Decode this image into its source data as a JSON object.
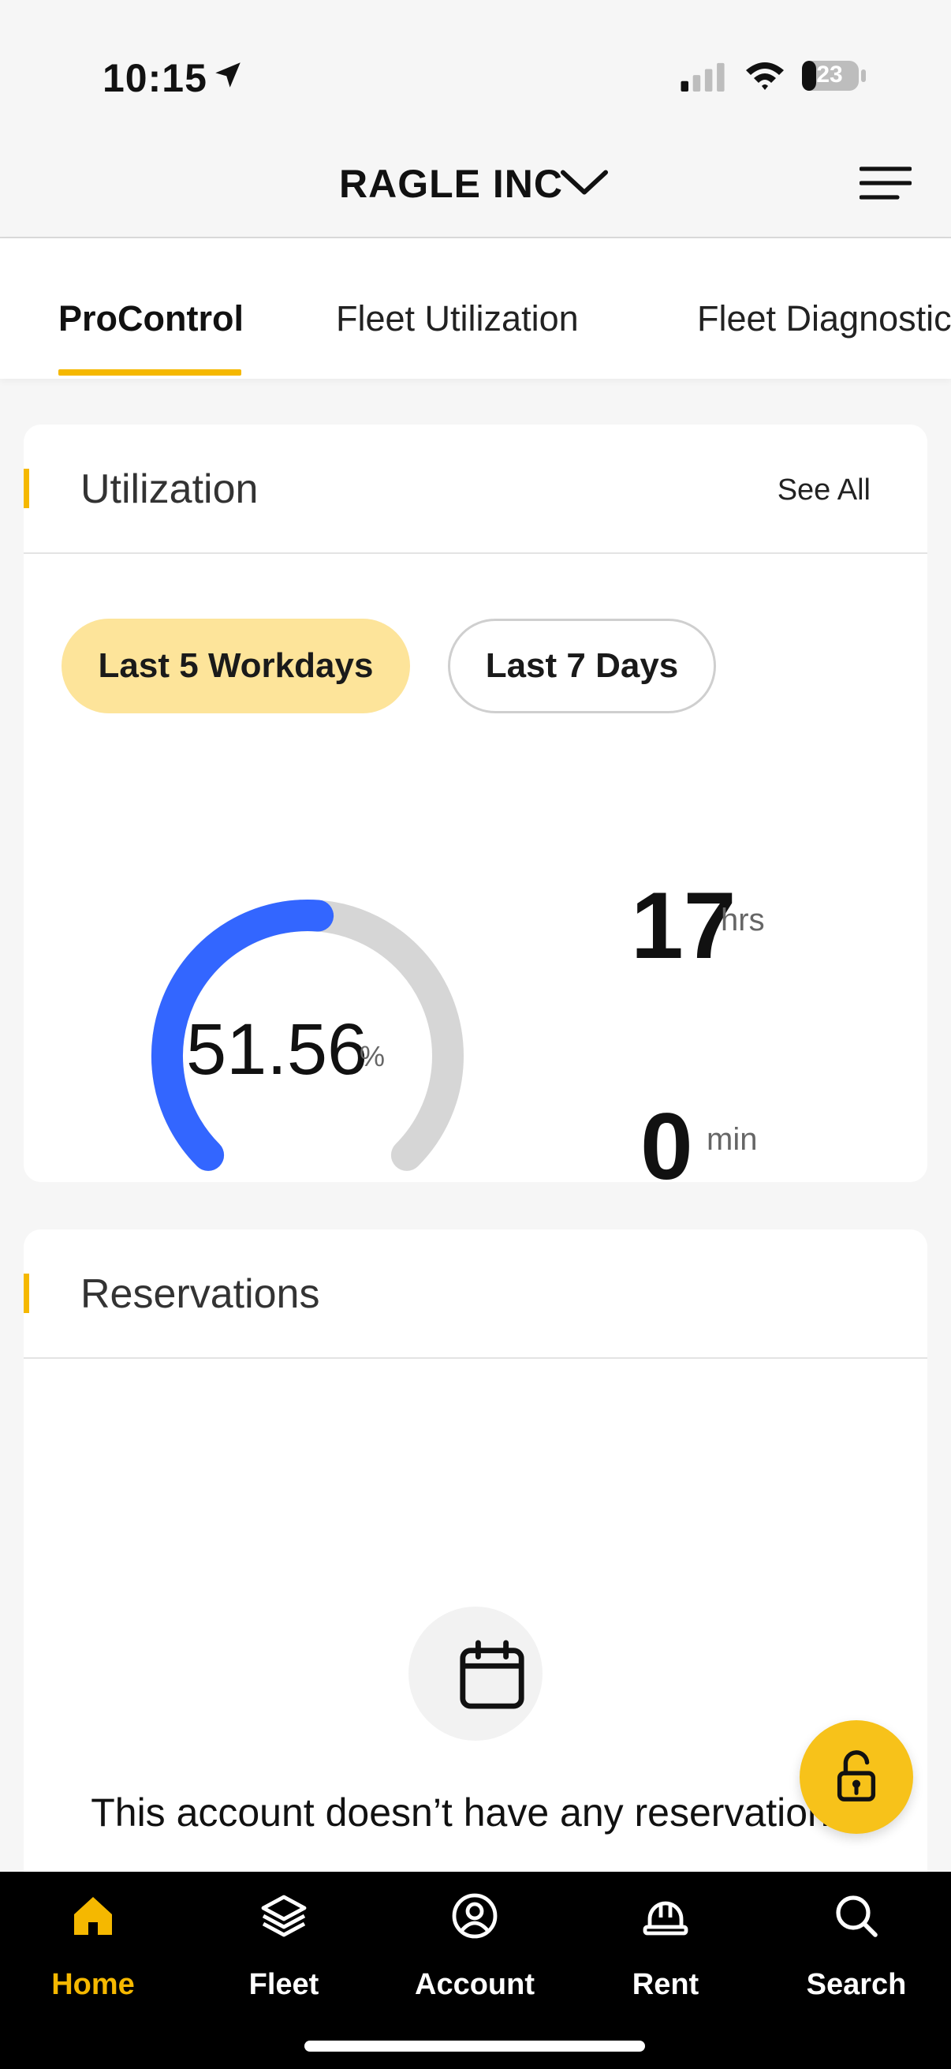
{
  "status_bar": {
    "time": "10:15",
    "battery": "23"
  },
  "header": {
    "company": "RAGLE INC"
  },
  "tabs": [
    {
      "label": "ProControl"
    },
    {
      "label": "Fleet Utilization"
    },
    {
      "label": "Fleet Diagnostics"
    }
  ],
  "utilization": {
    "title": "Utilization",
    "see_all": "See All",
    "filters": {
      "active": "Last 5 Workdays",
      "inactive": "Last 7 Days"
    },
    "percent": "51.56",
    "percent_unit": "%",
    "hours": "17",
    "hours_unit": "hrs",
    "minutes": "0",
    "minutes_unit": "min"
  },
  "reservations": {
    "title": "Reservations",
    "empty_message": "This account doesn’t have any reservations."
  },
  "nav": [
    {
      "label": "Home"
    },
    {
      "label": "Fleet"
    },
    {
      "label": "Account"
    },
    {
      "label": "Rent"
    },
    {
      "label": "Search"
    }
  ],
  "colors": {
    "accent": "#f5b800",
    "gauge_fill": "#3366ff",
    "gauge_track": "#d6d6d6",
    "pill_active": "#fde49a"
  },
  "gauge_fraction": 0.5156
}
